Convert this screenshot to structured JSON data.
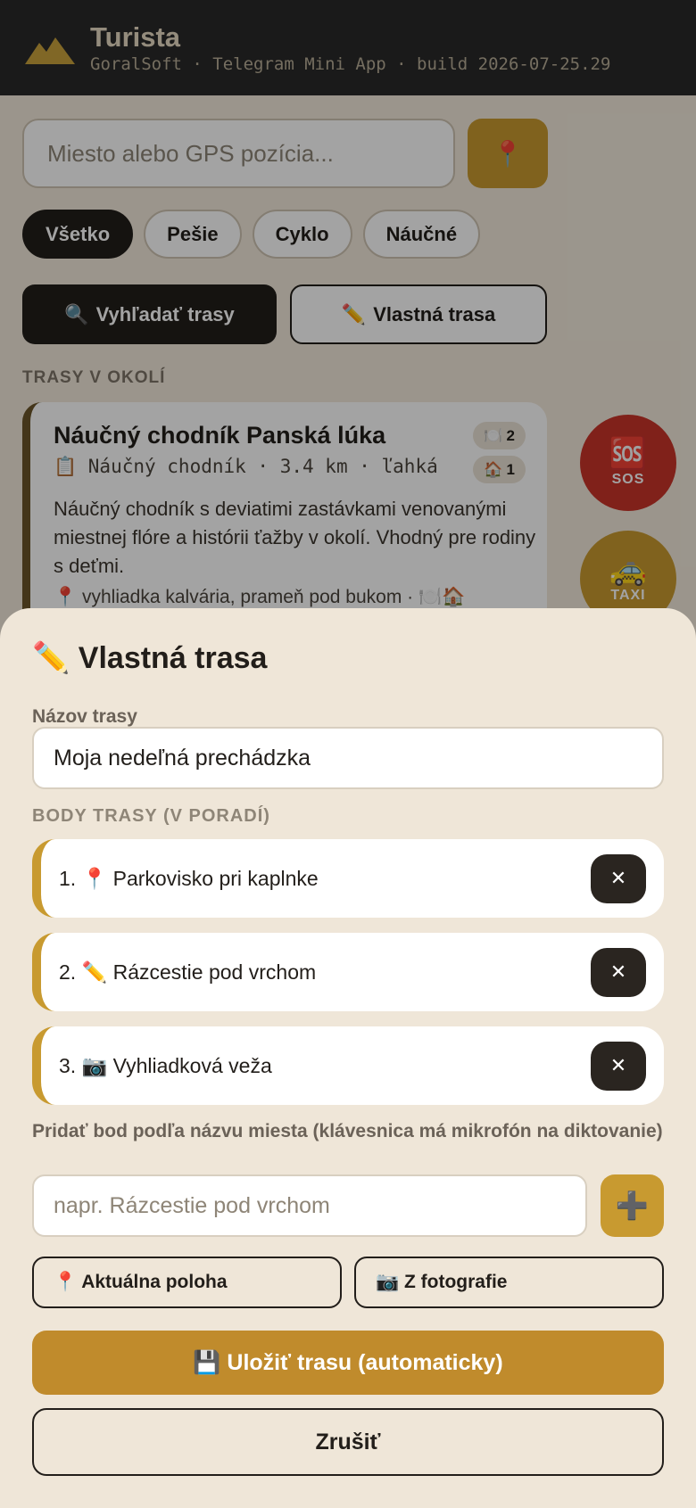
{
  "header": {
    "title": "Turista",
    "subtitle": "GoralSoft · Telegram Mini App · build 2026-07-25.29",
    "logo_icon": "mountain-logo-icon"
  },
  "search": {
    "placeholder": "Miesto alebo GPS pozícia...",
    "gps_icon": "📍"
  },
  "filters": {
    "items": [
      {
        "label": "Všetko",
        "active": true
      },
      {
        "label": "Pešie",
        "active": false
      },
      {
        "label": "Cyklo",
        "active": false
      },
      {
        "label": "Náučné",
        "active": false
      }
    ]
  },
  "actions": {
    "search_icon": "🔍",
    "search_label": "Vyhľadať trasy",
    "custom_icon": "✏️",
    "custom_label": "Vlastná trasa"
  },
  "nearby": {
    "section_label": "TRASY V OKOLÍ",
    "route": {
      "title": "Náučný chodník Panská lúka",
      "meta": "📋 Náučný chodník · 3.4 km · ľahká",
      "badge_food_icon": "🍽️",
      "badge_food_count": "2",
      "badge_house_icon": "🏠",
      "badge_house_count": "1",
      "description": "Náučný chodník s deviatimi zastávkami venovanými miestnej flóre a histórii ťažby v okolí. Vhodný pre rodiny s deťmi.",
      "points": "📍 vyhliadka kalvária, prameň pod bukom · 🍽️🏠"
    }
  },
  "fabs": {
    "sos_icon": "🆘",
    "sos_label": "SOS",
    "taxi_icon": "🚕",
    "taxi_label": "TAXI"
  },
  "sheet": {
    "title_icon": "✏️",
    "title": "Vlastná trasa",
    "name_label": "Názov trasy",
    "name_value": "Moja nedeľná prechádzka",
    "points_label": "BODY TRASY (V PORADÍ)",
    "points": [
      {
        "text": "1. 📍 Parkovisko pri kaplnke",
        "remove": "✕"
      },
      {
        "text": "2. ✏️ Rázcestie pod vrchom",
        "remove": "✕"
      },
      {
        "text": "3. 📷 Vyhliadková veža",
        "remove": "✕"
      }
    ],
    "add_label": "Pridať bod podľa názvu miesta (klávesnica má mikrofón na diktovanie)",
    "add_placeholder": "napr. Rázcestie pod vrchom",
    "add_button": "➕",
    "location_button": "📍 Aktuálna poloha",
    "photo_button": "📷 Z fotografie",
    "save_button": "💾 Uložiť trasu (automaticky)",
    "cancel_button": "Zrušiť"
  },
  "colors": {
    "accent": "#c89a30",
    "dark": "#221e1a",
    "sos": "#c8352a",
    "sheet_bg": "#efe6d8"
  }
}
